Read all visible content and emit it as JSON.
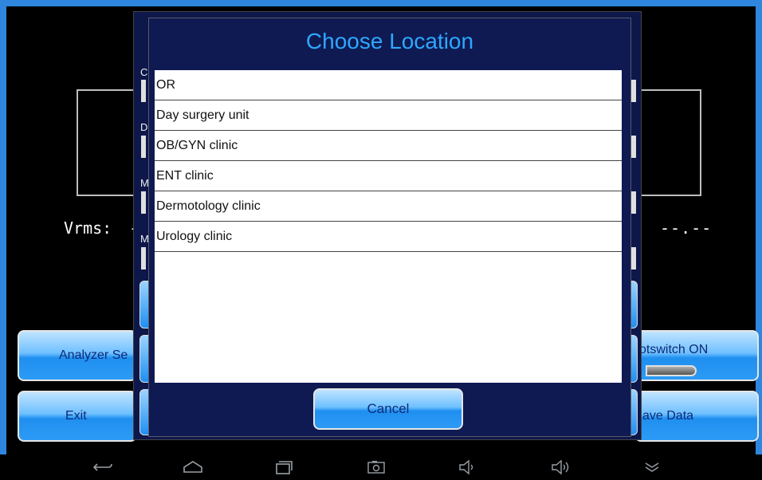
{
  "dialog": {
    "title": "Choose Location",
    "options": [
      "OR",
      "Day surgery unit",
      "OB/GYN clinic",
      "ENT clinic",
      "Dermotology clinic",
      "Urology clinic"
    ],
    "cancel_label": "Cancel"
  },
  "background": {
    "vrms_label": "Vrms:",
    "vrms_value": "-",
    "right_value": "--.--",
    "fragment_letters": [
      "C",
      "D",
      "M",
      "M"
    ],
    "buttons": {
      "analyzer_settings": "Analyzer Se",
      "exit": "Exit",
      "footswitch": "otswitch ON",
      "save_data": "ave Data"
    }
  },
  "colors": {
    "accent": "#2e86de",
    "dialog_bg": "#0f1a52",
    "title": "#2ea7ff",
    "button_text": "#0c2a79"
  },
  "navbar": {
    "icons": [
      "back-icon",
      "home-icon",
      "recent-apps-icon",
      "screenshot-icon",
      "volume-down-icon",
      "volume-up-icon",
      "collapse-icon"
    ]
  }
}
